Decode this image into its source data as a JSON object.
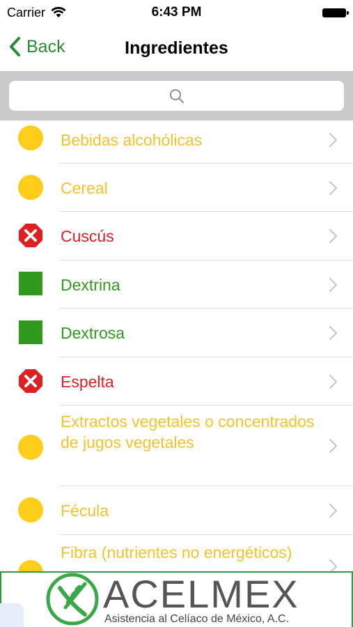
{
  "status_bar": {
    "carrier": "Carrier",
    "time": "6:43 PM"
  },
  "nav": {
    "back_label": "Back",
    "title": "Ingredientes"
  },
  "search": {
    "placeholder": ""
  },
  "items": [
    {
      "label": "Bebidas alcohólicas",
      "status": "yellow",
      "icon": "yellow-circle-icon"
    },
    {
      "label": "Cereal",
      "status": "yellow",
      "icon": "yellow-circle-icon"
    },
    {
      "label": "Cuscús",
      "status": "red",
      "icon": "red-octagon-x-icon"
    },
    {
      "label": "Dextrina",
      "status": "green",
      "icon": "green-square-icon"
    },
    {
      "label": "Dextrosa",
      "status": "green",
      "icon": "green-square-icon"
    },
    {
      "label": "Espelta",
      "status": "red",
      "icon": "red-octagon-x-icon"
    },
    {
      "label": "Extractos vegetales o concentrados de jugos vegetales",
      "status": "yellow",
      "icon": "yellow-circle-icon"
    },
    {
      "label": "Fécula",
      "status": "yellow",
      "icon": "yellow-circle-icon"
    },
    {
      "label": "Fibra (nutrientes no energéticos)",
      "status": "yellow",
      "icon": "yellow-circle-icon"
    }
  ],
  "banner": {
    "title": "ACELMEX",
    "subtitle": "Asistencia al Celíaco de México, A.C."
  },
  "colors": {
    "accent": "#2a8a36",
    "yellow": "#f4c22b",
    "red": "#e02020",
    "green": "#2f9a1e"
  }
}
